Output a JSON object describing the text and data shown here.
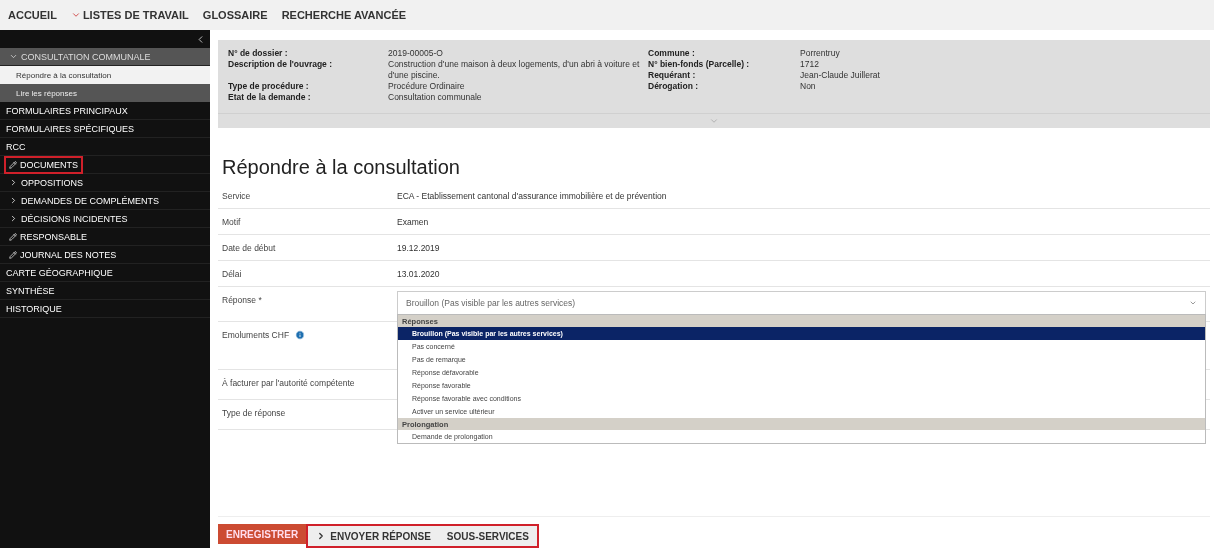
{
  "topnav": [
    {
      "label": "ACCUEIL",
      "caret": false
    },
    {
      "label": "LISTES DE TRAVAIL",
      "caret": true
    },
    {
      "label": "GLOSSAIRE",
      "caret": false
    },
    {
      "label": "RECHERCHE AVANCÉE",
      "caret": false
    }
  ],
  "sidebar": {
    "items": [
      {
        "label": "CONSULTATION COMMUNALE",
        "kind": "expander",
        "expanded": true,
        "outlined": false,
        "children": [
          {
            "label": "Répondre à la consultation",
            "selected": true
          },
          {
            "label": "Lire les réponses",
            "selected": false
          }
        ]
      },
      {
        "label": "FORMULAIRES PRINCIPAUX",
        "kind": "plain",
        "outlined": false
      },
      {
        "label": "FORMULAIRES SPÉCIFIQUES",
        "kind": "plain",
        "outlined": false
      },
      {
        "label": "RCC",
        "kind": "plain",
        "outlined": false
      },
      {
        "label": "DOCUMENTS",
        "kind": "edit",
        "outlined": true
      },
      {
        "label": "OPPOSITIONS",
        "kind": "expander",
        "expanded": false,
        "outlined": false
      },
      {
        "label": "DEMANDES DE COMPLÉMENTS",
        "kind": "expander",
        "expanded": false,
        "outlined": false
      },
      {
        "label": "DÉCISIONS INCIDENTES",
        "kind": "expander",
        "expanded": false,
        "outlined": false
      },
      {
        "label": "RESPONSABLE",
        "kind": "edit",
        "outlined": false
      },
      {
        "label": "JOURNAL DES NOTES",
        "kind": "edit",
        "outlined": false
      },
      {
        "label": "CARTE GÉOGRAPHIQUE",
        "kind": "plain",
        "outlined": false
      },
      {
        "label": "SYNTHÈSE",
        "kind": "plain",
        "outlined": false
      },
      {
        "label": "HISTORIQUE",
        "kind": "plain",
        "outlined": false
      }
    ]
  },
  "summary": {
    "left": [
      {
        "label": "N° de dossier :",
        "value": "2019-00005-O"
      },
      {
        "label": "Description de l'ouvrage :",
        "value": "Construction d'une maison à deux logements, d'un abri à voiture et d'une piscine."
      },
      {
        "label": "Type de procédure :",
        "value": "Procédure Ordinaire"
      },
      {
        "label": "Etat de la demande :",
        "value": "Consultation communale"
      }
    ],
    "right": [
      {
        "label": "Commune :",
        "value": "Porrentruy"
      },
      {
        "label": "N° bien-fonds (Parcelle) :",
        "value": "1712"
      },
      {
        "label": "Requérant :",
        "value": "Jean-Claude Juillerat"
      },
      {
        "label": "Dérogation :",
        "value": "Non"
      }
    ]
  },
  "form": {
    "title": "Répondre à la consultation",
    "rows": [
      {
        "label": "Service",
        "kind": "text",
        "value": "ECA - Etablissement cantonal d'assurance immobilière et de prévention"
      },
      {
        "label": "Motif",
        "kind": "text",
        "value": "Examen"
      },
      {
        "label": "Date de début",
        "kind": "text",
        "value": "19.12.2019"
      },
      {
        "label": "Délai",
        "kind": "text",
        "value": "13.01.2020"
      },
      {
        "label": "Réponse *",
        "kind": "select",
        "value": "Brouillon (Pas visible par les autres services)",
        "expanded": true,
        "groups": [
          {
            "label": "Réponses",
            "options": [
              {
                "label": "Brouillon (Pas visible par les autres services)",
                "selected": true
              },
              {
                "label": "Pas concerné",
                "selected": false
              },
              {
                "label": "Pas de remarque",
                "selected": false
              },
              {
                "label": "Réponse défavorable",
                "selected": false
              },
              {
                "label": "Réponse favorable",
                "selected": false
              },
              {
                "label": "Réponse favorable avec conditions",
                "selected": false
              },
              {
                "label": "Activer un service ultérieur",
                "selected": false
              }
            ]
          },
          {
            "label": "Prolongation",
            "options": [
              {
                "label": "Demande de prolongation",
                "selected": false
              }
            ]
          }
        ]
      },
      {
        "label": "Emoluments CHF",
        "kind": "info"
      },
      {
        "label": "À facturer par l'autorité compétente",
        "kind": "blank"
      },
      {
        "label": "Type de réponse",
        "kind": "blank"
      }
    ]
  },
  "buttons": [
    {
      "label": "ENREGISTRER",
      "kind": "primary",
      "outlined": false,
      "chevron": false
    },
    {
      "label": "ENVOYER RÉPONSE",
      "kind": "secondary",
      "outlined": true,
      "chevron": true
    },
    {
      "label": "SOUS-SERVICES",
      "kind": "secondary",
      "outlined": true,
      "chevron": false
    }
  ]
}
